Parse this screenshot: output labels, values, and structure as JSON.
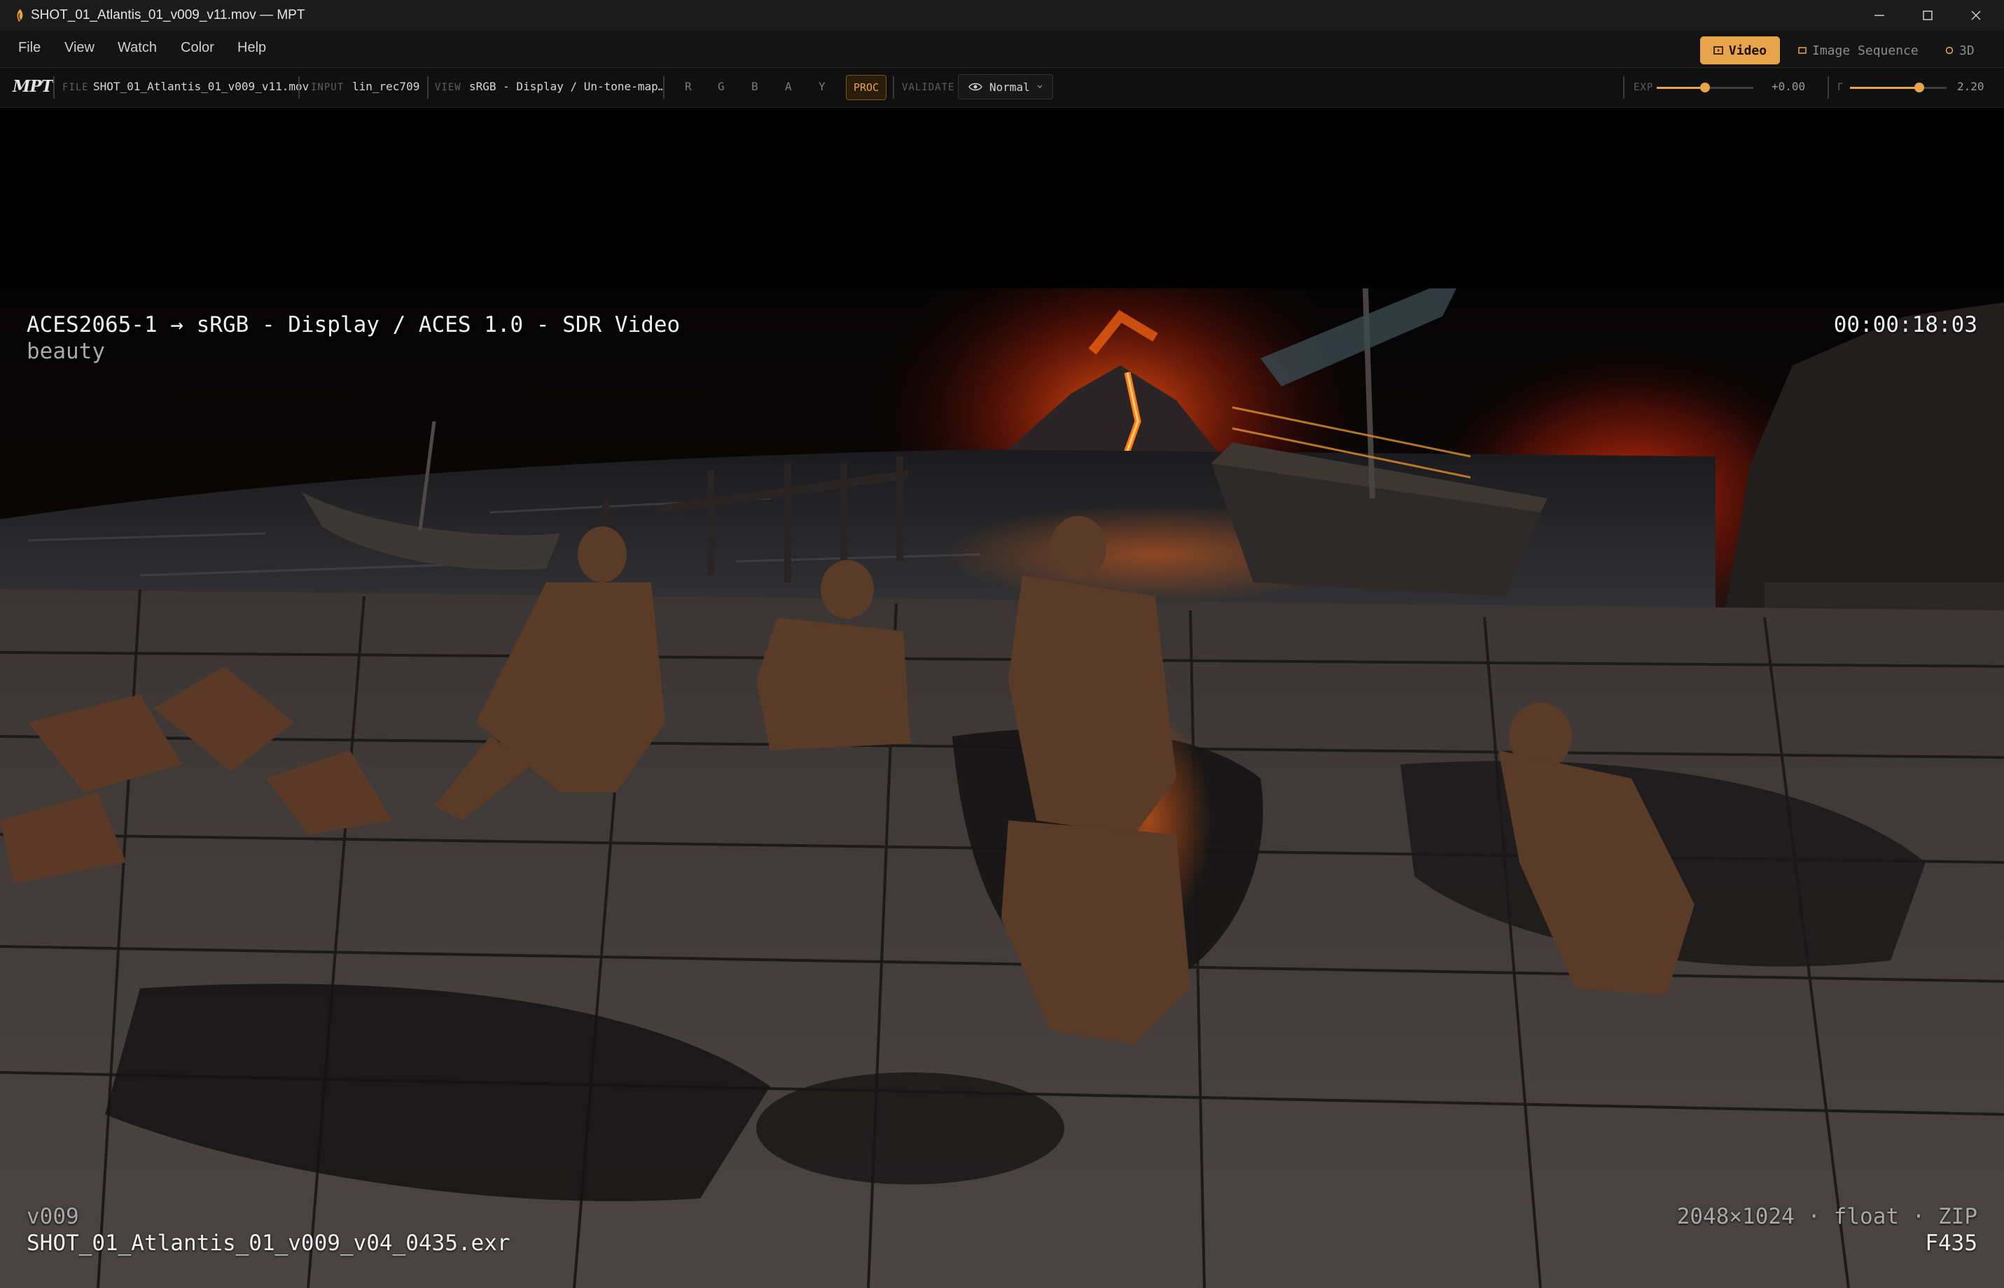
{
  "window": {
    "title": "SHOT_01_Atlantis_01_v009_v11.mov — MPT"
  },
  "menu": [
    "File",
    "View",
    "Watch",
    "Color",
    "Help"
  ],
  "modes": {
    "video": "Video",
    "image_sequence": "Image Sequence",
    "three_d": "3D"
  },
  "toolbar": {
    "logo": "MPT",
    "file_label": "FILE",
    "file_value": "SHOT_01_Atlantis_01_v009_v11.mov",
    "input_label": "INPUT",
    "input_value": "lin_rec709",
    "view_label": "VIEW",
    "view_value": "sRGB - Display / Un-tone-map…",
    "channels": [
      "R",
      "G",
      "B",
      "A",
      "Y"
    ],
    "proc": "PROC",
    "validate_label": "VALIDATE",
    "validate_value": "Normal",
    "exposure_label": "EXP",
    "exposure_value": "+0.00",
    "exposure_level": 0.5,
    "gamma_label": "Γ",
    "gamma_value": "2.20",
    "gamma_level": 0.72
  },
  "overlay": {
    "transform": "ACES2065-1  →  sRGB - Display / ACES 1.0 - SDR Video",
    "layer": "beauty",
    "timecode": "00:00:18:03",
    "version": "v009",
    "filename": "SHOT_01_Atlantis_01_v009_v04_0435.exr",
    "specs": "2048×1024  ·  float  ·  ZIP",
    "frame": "F435"
  },
  "colors": {
    "accent": "#e7a44b",
    "lava": "#ff4a10"
  }
}
